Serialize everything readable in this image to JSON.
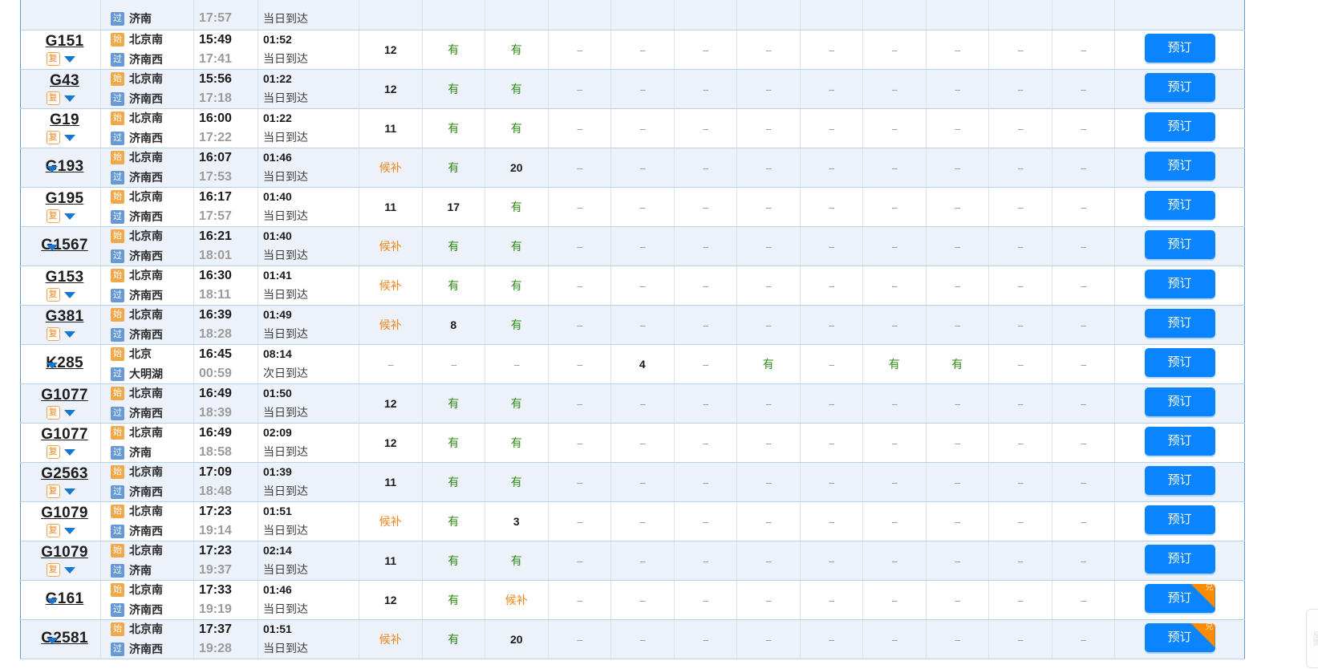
{
  "table": {
    "booking_label": "预订",
    "exchange_badge": "兑",
    "tag_start": "始",
    "tag_pass": "过",
    "badge_fu": "复",
    "seat_columns": 12,
    "values": {
      "available": "有",
      "waitlist": "候补",
      "none": "--"
    }
  },
  "float_widget": {
    "text": "反馈"
  },
  "rows": [
    {
      "train_no": "",
      "has_fu": false,
      "partial": true,
      "dep_station": "",
      "arr_station": "济南",
      "dep_time": "",
      "arr_time": "17:57",
      "duration": "",
      "arrive_day": "当日到达",
      "seats": [
        "--",
        "--",
        "--",
        "--",
        "--",
        "--",
        "--",
        "--",
        "--",
        "--",
        "--",
        "--"
      ],
      "badge": false
    },
    {
      "train_no": "G151",
      "has_fu": true,
      "partial": false,
      "dep_station": "北京南",
      "arr_station": "济南西",
      "dep_time": "15:49",
      "arr_time": "17:41",
      "duration": "01:52",
      "arrive_day": "当日到达",
      "seats": [
        "12",
        "有",
        "有",
        "--",
        "--",
        "--",
        "--",
        "--",
        "--",
        "--",
        "--",
        "--"
      ],
      "badge": false
    },
    {
      "train_no": "G43",
      "has_fu": true,
      "partial": false,
      "dep_station": "北京南",
      "arr_station": "济南西",
      "dep_time": "15:56",
      "arr_time": "17:18",
      "duration": "01:22",
      "arrive_day": "当日到达",
      "seats": [
        "12",
        "有",
        "有",
        "--",
        "--",
        "--",
        "--",
        "--",
        "--",
        "--",
        "--",
        "--"
      ],
      "badge": false
    },
    {
      "train_no": "G19",
      "has_fu": true,
      "partial": false,
      "dep_station": "北京南",
      "arr_station": "济南西",
      "dep_time": "16:00",
      "arr_time": "17:22",
      "duration": "01:22",
      "arrive_day": "当日到达",
      "seats": [
        "11",
        "有",
        "有",
        "--",
        "--",
        "--",
        "--",
        "--",
        "--",
        "--",
        "--",
        "--"
      ],
      "badge": false
    },
    {
      "train_no": "G193",
      "has_fu": false,
      "partial": false,
      "dep_station": "北京南",
      "arr_station": "济南西",
      "dep_time": "16:07",
      "arr_time": "17:53",
      "duration": "01:46",
      "arrive_day": "当日到达",
      "seats": [
        "候补",
        "有",
        "20",
        "--",
        "--",
        "--",
        "--",
        "--",
        "--",
        "--",
        "--",
        "--"
      ],
      "badge": false
    },
    {
      "train_no": "G195",
      "has_fu": true,
      "partial": false,
      "dep_station": "北京南",
      "arr_station": "济南西",
      "dep_time": "16:17",
      "arr_time": "17:57",
      "duration": "01:40",
      "arrive_day": "当日到达",
      "seats": [
        "11",
        "17",
        "有",
        "--",
        "--",
        "--",
        "--",
        "--",
        "--",
        "--",
        "--",
        "--"
      ],
      "badge": false
    },
    {
      "train_no": "G1567",
      "has_fu": false,
      "partial": false,
      "dep_station": "北京南",
      "arr_station": "济南西",
      "dep_time": "16:21",
      "arr_time": "18:01",
      "duration": "01:40",
      "arrive_day": "当日到达",
      "seats": [
        "候补",
        "有",
        "有",
        "--",
        "--",
        "--",
        "--",
        "--",
        "--",
        "--",
        "--",
        "--"
      ],
      "badge": false
    },
    {
      "train_no": "G153",
      "has_fu": true,
      "partial": false,
      "dep_station": "北京南",
      "arr_station": "济南西",
      "dep_time": "16:30",
      "arr_time": "18:11",
      "duration": "01:41",
      "arrive_day": "当日到达",
      "seats": [
        "候补",
        "有",
        "有",
        "--",
        "--",
        "--",
        "--",
        "--",
        "--",
        "--",
        "--",
        "--"
      ],
      "badge": false
    },
    {
      "train_no": "G381",
      "has_fu": true,
      "partial": false,
      "dep_station": "北京南",
      "arr_station": "济南西",
      "dep_time": "16:39",
      "arr_time": "18:28",
      "duration": "01:49",
      "arrive_day": "当日到达",
      "seats": [
        "候补",
        "8",
        "有",
        "--",
        "--",
        "--",
        "--",
        "--",
        "--",
        "--",
        "--",
        "--"
      ],
      "badge": false
    },
    {
      "train_no": "K285",
      "has_fu": false,
      "partial": false,
      "dep_station": "北京",
      "arr_station": "大明湖",
      "dep_time": "16:45",
      "arr_time": "00:59",
      "duration": "08:14",
      "arrive_day": "次日到达",
      "seats": [
        "--",
        "--",
        "--",
        "--",
        "4",
        "--",
        "有",
        "--",
        "有",
        "有",
        "--",
        "--"
      ],
      "badge": false
    },
    {
      "train_no": "G1077",
      "has_fu": true,
      "partial": false,
      "dep_station": "北京南",
      "arr_station": "济南西",
      "dep_time": "16:49",
      "arr_time": "18:39",
      "duration": "01:50",
      "arrive_day": "当日到达",
      "seats": [
        "12",
        "有",
        "有",
        "--",
        "--",
        "--",
        "--",
        "--",
        "--",
        "--",
        "--",
        "--"
      ],
      "badge": false
    },
    {
      "train_no": "G1077",
      "has_fu": true,
      "partial": false,
      "dep_station": "北京南",
      "arr_station": "济南",
      "dep_time": "16:49",
      "arr_time": "18:58",
      "duration": "02:09",
      "arrive_day": "当日到达",
      "seats": [
        "12",
        "有",
        "有",
        "--",
        "--",
        "--",
        "--",
        "--",
        "--",
        "--",
        "--",
        "--"
      ],
      "badge": false
    },
    {
      "train_no": "G2563",
      "has_fu": true,
      "partial": false,
      "dep_station": "北京南",
      "arr_station": "济南西",
      "dep_time": "17:09",
      "arr_time": "18:48",
      "duration": "01:39",
      "arrive_day": "当日到达",
      "seats": [
        "11",
        "有",
        "有",
        "--",
        "--",
        "--",
        "--",
        "--",
        "--",
        "--",
        "--",
        "--"
      ],
      "badge": false
    },
    {
      "train_no": "G1079",
      "has_fu": true,
      "partial": false,
      "dep_station": "北京南",
      "arr_station": "济南西",
      "dep_time": "17:23",
      "arr_time": "19:14",
      "duration": "01:51",
      "arrive_day": "当日到达",
      "seats": [
        "候补",
        "有",
        "3",
        "--",
        "--",
        "--",
        "--",
        "--",
        "--",
        "--",
        "--",
        "--"
      ],
      "badge": false
    },
    {
      "train_no": "G1079",
      "has_fu": true,
      "partial": false,
      "dep_station": "北京南",
      "arr_station": "济南",
      "dep_time": "17:23",
      "arr_time": "19:37",
      "duration": "02:14",
      "arrive_day": "当日到达",
      "seats": [
        "11",
        "有",
        "有",
        "--",
        "--",
        "--",
        "--",
        "--",
        "--",
        "--",
        "--",
        "--"
      ],
      "badge": false
    },
    {
      "train_no": "G161",
      "has_fu": false,
      "partial": false,
      "dep_station": "北京南",
      "arr_station": "济南西",
      "dep_time": "17:33",
      "arr_time": "19:19",
      "duration": "01:46",
      "arrive_day": "当日到达",
      "seats": [
        "12",
        "有",
        "候补",
        "--",
        "--",
        "--",
        "--",
        "--",
        "--",
        "--",
        "--",
        "--"
      ],
      "badge": true
    },
    {
      "train_no": "G2581",
      "has_fu": false,
      "partial": false,
      "dep_station": "北京南",
      "arr_station": "济南西",
      "dep_time": "17:37",
      "arr_time": "19:28",
      "duration": "01:51",
      "arrive_day": "当日到达",
      "seats": [
        "候补",
        "有",
        "20",
        "--",
        "--",
        "--",
        "--",
        "--",
        "--",
        "--",
        "--",
        "--"
      ],
      "badge": true
    }
  ]
}
